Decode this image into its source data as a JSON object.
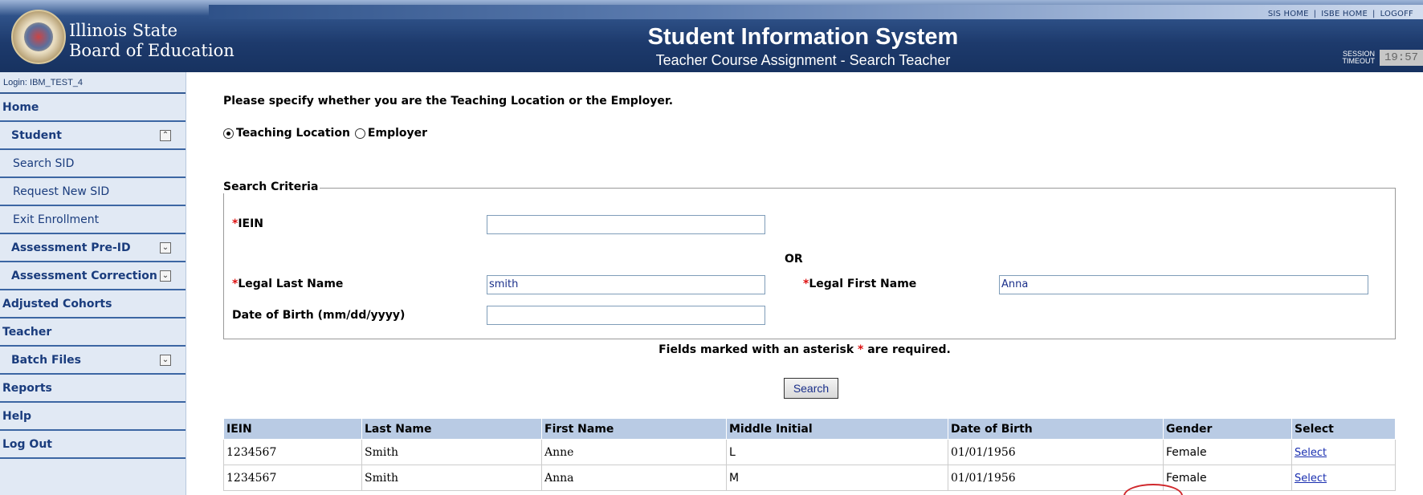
{
  "header": {
    "org_line1": "Illinois State",
    "org_line2": "Board of Education",
    "title": "Student Information System",
    "subtitle": "Teacher Course Assignment - Search Teacher",
    "links": [
      "SIS HOME",
      "ISBE HOME",
      "LOGOFF"
    ],
    "session_label_1": "SESSION",
    "session_label_2": "TIMEOUT",
    "session_timer": "19:57"
  },
  "sidebar": {
    "login": "Login: IBM_TEST_4",
    "items": [
      {
        "label": "Home",
        "level": "top"
      },
      {
        "label": "Student",
        "level": "top",
        "chevron": "up"
      },
      {
        "label": "Search SID",
        "level": "sub"
      },
      {
        "label": "Request New SID",
        "level": "sub"
      },
      {
        "label": "Exit Enrollment",
        "level": "sub"
      },
      {
        "label": "Assessment Pre-ID",
        "level": "top",
        "chevron": "down"
      },
      {
        "label": "Assessment Correction",
        "level": "top",
        "chevron": "down"
      },
      {
        "label": "Adjusted Cohorts",
        "level": "top"
      },
      {
        "label": "Teacher",
        "level": "top"
      },
      {
        "label": "Batch Files",
        "level": "top",
        "chevron": "down"
      },
      {
        "label": "Reports",
        "level": "top"
      },
      {
        "label": "Help",
        "level": "top"
      },
      {
        "label": "Log Out",
        "level": "top"
      }
    ]
  },
  "main": {
    "prompt": "Please specify whether you are the Teaching Location or the Employer.",
    "radio_teaching": "Teaching Location",
    "radio_employer": "Employer",
    "selected_radio": "Teaching Location",
    "legend": "Search Criteria",
    "ieim_label": "IEIN",
    "ieim_value": "",
    "or_label": "OR",
    "last_name_label": "Legal Last Name",
    "last_name_value": "smith",
    "first_name_label": "Legal First Name",
    "first_name_value": "Anna",
    "dob_label": "Date of Birth (mm/dd/yyyy)",
    "dob_value": "",
    "required_note_1": "Fields marked with an asterisk",
    "required_note_2": "are required.",
    "search_button": "Search"
  },
  "results": {
    "columns": [
      "IEIN",
      "Last Name",
      "First Name",
      "Middle Initial",
      "Date of Birth",
      "Gender",
      "Select"
    ],
    "rows": [
      {
        "iein": "1234567",
        "last": "Smith",
        "first": "Anne",
        "middle": "L",
        "dob": "01/01/1956",
        "gender": "Female",
        "select": "Select"
      },
      {
        "iein": "1234567",
        "last": "Smith",
        "first": "Anna",
        "middle": "M",
        "dob": "01/01/1956",
        "gender": "Female",
        "select": "Select"
      }
    ]
  },
  "colors": {
    "header_dark": "#1d3a6c",
    "sidebar_bg": "#e1e9f4",
    "table_header_bg": "#b9cbe4",
    "highlight": "#d0282c"
  }
}
